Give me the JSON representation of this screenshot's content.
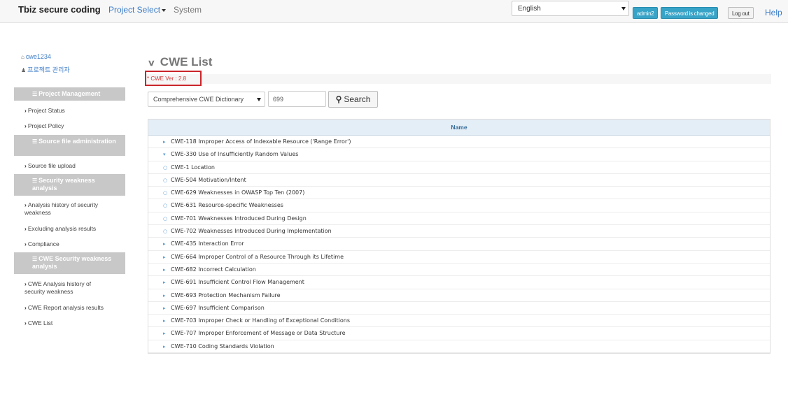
{
  "navbar": {
    "brand": "Tbiz secure coding",
    "project_select": "Project Select",
    "system": "System",
    "language": "English",
    "user_button": "admin2",
    "password_button": "Password is changed",
    "logout_button": "Log out",
    "help": "Help"
  },
  "sidebar": {
    "user": "cwe1234",
    "role": "프로젝트 관리자",
    "sections": [
      {
        "title": "Project Management",
        "items": [
          "Project Status",
          "Project Policy"
        ]
      },
      {
        "title": "Source file administration",
        "items": [
          "Source file upload"
        ]
      },
      {
        "title": "Security weakness analysis",
        "items": [
          "Analysis history of security weakness",
          "Excluding analysis results",
          "Compliance"
        ]
      },
      {
        "title": "CWE Security weakness analysis",
        "items": [
          "CWE Analysis history of security weakness",
          "CWE Report analysis results",
          "CWE List"
        ]
      }
    ]
  },
  "main": {
    "title": "CWE List",
    "version": "* CWE Ver : 2.8",
    "dictionary_select": "Comprehensive CWE Dictionary",
    "search_value": "699",
    "search_button": "Search",
    "table": {
      "header": "Name",
      "rows": [
        {
          "marker": "collapsed",
          "text": "CWE-118 Improper Access of Indexable Resource ('Range Error')"
        },
        {
          "marker": "expanded",
          "text": "CWE-330 Use of Insufficiently Random Values"
        },
        {
          "marker": "leaf",
          "text": "CWE-1 Location"
        },
        {
          "marker": "leaf",
          "text": "CWE-504 Motivation/Intent"
        },
        {
          "marker": "leaf",
          "text": "CWE-629 Weaknesses in OWASP Top Ten (2007)"
        },
        {
          "marker": "leaf",
          "text": "CWE-631 Resource-specific Weaknesses"
        },
        {
          "marker": "leaf",
          "text": "CWE-701 Weaknesses Introduced During Design"
        },
        {
          "marker": "leaf",
          "text": "CWE-702 Weaknesses Introduced During Implementation"
        },
        {
          "marker": "collapsed",
          "text": "CWE-435 Interaction Error"
        },
        {
          "marker": "collapsed",
          "text": "CWE-664 Improper Control of a Resource Through its Lifetime"
        },
        {
          "marker": "collapsed",
          "text": "CWE-682 Incorrect Calculation"
        },
        {
          "marker": "collapsed",
          "text": "CWE-691 Insufficient Control Flow Management"
        },
        {
          "marker": "collapsed",
          "text": "CWE-693 Protection Mechanism Failure"
        },
        {
          "marker": "collapsed",
          "text": "CWE-697 Insufficient Comparison"
        },
        {
          "marker": "collapsed",
          "text": "CWE-703 Improper Check or Handling of Exceptional Conditions"
        },
        {
          "marker": "collapsed",
          "text": "CWE-707 Improper Enforcement of Message or Data Structure"
        },
        {
          "marker": "collapsed",
          "text": "CWE-710 Coding Standards Violation"
        }
      ]
    }
  },
  "icons": {
    "home": "home-icon",
    "user": "user-icon",
    "list": "list-icon",
    "chevron": "chevron-right-icon",
    "search": "search-icon"
  },
  "colors": {
    "brand_link": "#3a7bc8",
    "button_blue": "#37a3c7",
    "sidebar_header": "#c8c8c8",
    "table_header": "#e4eef6",
    "highlight_box": "#c9252b"
  }
}
